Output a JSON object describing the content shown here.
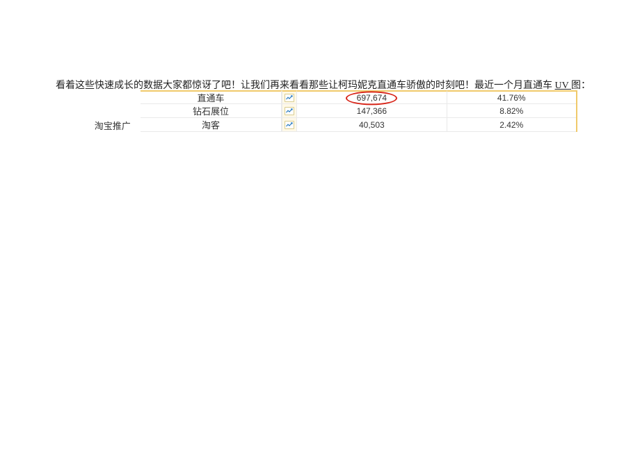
{
  "intro": {
    "prefix": "看着这些快速成长的数据大家都惊讶了吧！让我们再来看看那些让柯玛妮克直通车骄傲的时刻吧！最近一个月直通车 ",
    "uv_label": "UV ",
    "suffix": "图："
  },
  "table": {
    "category_label": "淘宝推广",
    "rows": [
      {
        "name": "直通车",
        "value": "697,674",
        "pct": "41.76%",
        "highlight": true
      },
      {
        "name": "钻石展位",
        "value": "147,366",
        "pct": "8.82%",
        "highlight": false
      },
      {
        "name": "淘客",
        "value": "40,503",
        "pct": "2.42%",
        "highlight": false
      }
    ]
  },
  "icons": {
    "trend": "trend-icon"
  }
}
